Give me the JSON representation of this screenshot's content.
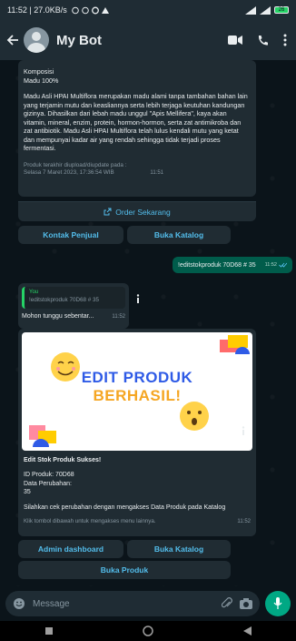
{
  "status": {
    "left": "11:52 | 27.0KB/s",
    "right_battery": "26"
  },
  "header": {
    "title": "My Bot"
  },
  "message1": {
    "section_label": "Komposisi",
    "composition": "Madu 100%",
    "paragraph1": "Madu Asli HPAI Multiflora merupakan madu alami tanpa tambahan bahan lain yang terjamin mutu dan keasliannya serta lebih terjaga keutuhan kandungan gizinya. Dihasilkan dari lebah madu unggul \"Apis Mellifera\", kaya akan vitamin, mineral, enzim, protein, hormon-hormon, serta zat antimikroba dan zat antibiotik. Madu Asli HPAI Multiflora telah lulus kendali mutu yang ketat dan mempunyai kadar air yang rendah sehingga tidak terjadi proses fermentasi.",
    "footer_line1": "Produk terakhir diupload/diupdate pada :",
    "footer_line2": "Selasa 7 Maret 2023, 17:36:54 WIB",
    "time": "11:51",
    "order_link": "Order Sekarang"
  },
  "buttons1": {
    "contact": "Kontak Penjual",
    "catalog": "Buka Katalog"
  },
  "outgoing": {
    "text": "!editstokproduk 70D68 # 35",
    "time": "11:52"
  },
  "message2": {
    "quote_author": "You",
    "quote_text": "!editstokproduk 70D68 # 35",
    "text": "Mohon tunggu sebentar...",
    "time": "11:52"
  },
  "message3": {
    "banner_line1": "EDIT PRODUK",
    "banner_line2": "BERHASIL!",
    "title": "Edit Stok Produk Sukses!",
    "id_line": "ID Produk: 70D68",
    "changes_label": "Data Perubahan:",
    "changes_value": "35",
    "instruction": "Silahkan cek perubahan dengan mengakses Data Produk pada Katalog",
    "hint": "Klik tombol dibawah untuk mengakses menu lainnya.",
    "time": "11:52"
  },
  "buttons2": {
    "admin": "Admin dashboard",
    "catalog": "Buka Katalog",
    "product": "Buka Produk"
  },
  "input": {
    "placeholder": "Message"
  },
  "colors": {
    "accent": "#00a884",
    "link": "#53bdeb",
    "outgoing": "#005c4b",
    "incoming": "#202c33"
  }
}
